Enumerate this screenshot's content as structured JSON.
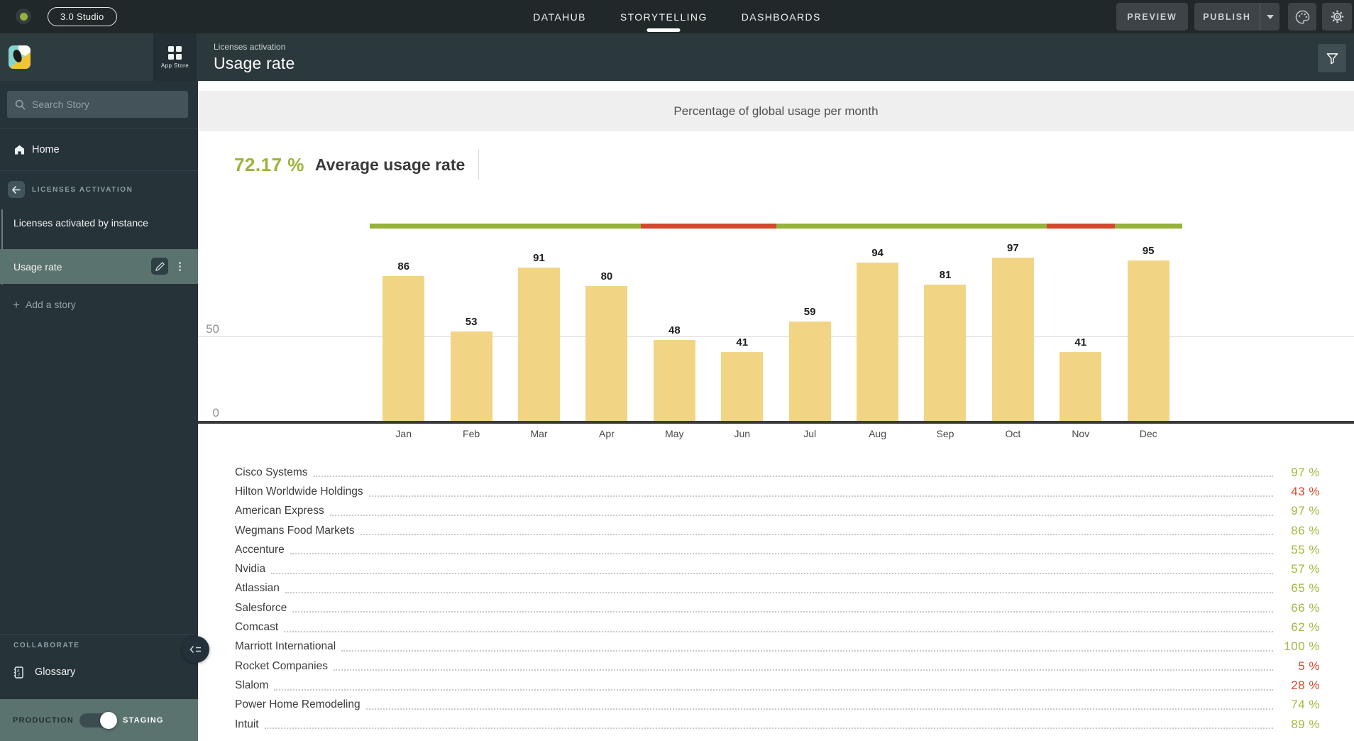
{
  "topbar": {
    "app_badge": "3.0 Studio",
    "nav": [
      {
        "label": "DATAHUB",
        "active": false
      },
      {
        "label": "STORYTELLING",
        "active": true
      },
      {
        "label": "DASHBOARDS",
        "active": false
      }
    ],
    "preview_label": "PREVIEW",
    "publish_label": "PUBLISH"
  },
  "header": {
    "breadcrumb": "Licenses activation",
    "title": "Usage rate",
    "app_store_label": "App Store"
  },
  "sidebar": {
    "search_placeholder": "Search Story",
    "home_label": "Home",
    "section_label": "LICENSES ACTIVATION",
    "stories": [
      {
        "label": "Licenses activated by instance",
        "active": false
      },
      {
        "label": "Usage rate",
        "active": true
      }
    ],
    "add_story_plus": "+",
    "add_story_label": "Add a story",
    "collaborate_label": "COLLABORATE",
    "glossary_label": "Glossary",
    "production_label": "PRODUCTION",
    "staging_label": "STAGING",
    "staging_enabled": true
  },
  "main": {
    "kpi_value": "72.17 %",
    "kpi_label": "Average usage rate"
  },
  "chart_data": {
    "type": "bar",
    "title": "Percentage of global usage per month",
    "categories": [
      "Jan",
      "Feb",
      "Mar",
      "Apr",
      "May",
      "Jun",
      "Jul",
      "Aug",
      "Sep",
      "Oct",
      "Nov",
      "Dec"
    ],
    "values": [
      86,
      53,
      91,
      80,
      48,
      41,
      59,
      94,
      81,
      97,
      41,
      95
    ],
    "ylim": [
      0,
      100
    ],
    "yticks": [
      50,
      0
    ],
    "ytick_labels": [
      "50",
      "0"
    ],
    "target": 50,
    "month_status": [
      "above",
      "above",
      "above",
      "above",
      "below",
      "below",
      "above",
      "above",
      "above",
      "above",
      "below",
      "above"
    ],
    "bar_color": "#f1d584",
    "trend_colors": {
      "above": "#94b23c",
      "below": "#d3492e"
    },
    "grid": true,
    "legend": false
  },
  "companies": {
    "rows": [
      {
        "name": "Cisco Systems",
        "value": 97,
        "display": "97 %",
        "status": "high"
      },
      {
        "name": "Hilton Worldwide Holdings",
        "value": 43,
        "display": "43 %",
        "status": "low"
      },
      {
        "name": "American Express",
        "value": 97,
        "display": "97 %",
        "status": "high"
      },
      {
        "name": "Wegmans Food Markets",
        "value": 86,
        "display": "86 %",
        "status": "high"
      },
      {
        "name": "Accenture",
        "value": 55,
        "display": "55 %",
        "status": "high"
      },
      {
        "name": "Nvidia",
        "value": 57,
        "display": "57 %",
        "status": "high"
      },
      {
        "name": "Atlassian",
        "value": 65,
        "display": "65 %",
        "status": "high"
      },
      {
        "name": "Salesforce",
        "value": 66,
        "display": "66 %",
        "status": "high"
      },
      {
        "name": "Comcast",
        "value": 62,
        "display": "62 %",
        "status": "high"
      },
      {
        "name": "Marriott International",
        "value": 100,
        "display": "100 %",
        "status": "high"
      },
      {
        "name": "Rocket Companies",
        "value": 5,
        "display": "5 %",
        "status": "low"
      },
      {
        "name": "Slalom",
        "value": 28,
        "display": "28 %",
        "status": "low"
      },
      {
        "name": "Power Home Remodeling",
        "value": 74,
        "display": "74 %",
        "status": "high"
      },
      {
        "name": "Intuit",
        "value": 89,
        "display": "89 %",
        "status": "high"
      }
    ]
  },
  "colors": {
    "positive": "#a3b93f",
    "negative": "#d3492e",
    "bar": "#f1d584",
    "kpi_green": "#9fb23a",
    "topbar_bg": "#212829",
    "sidebar_bg": "#263339",
    "selected_bg": "#5a736e"
  }
}
